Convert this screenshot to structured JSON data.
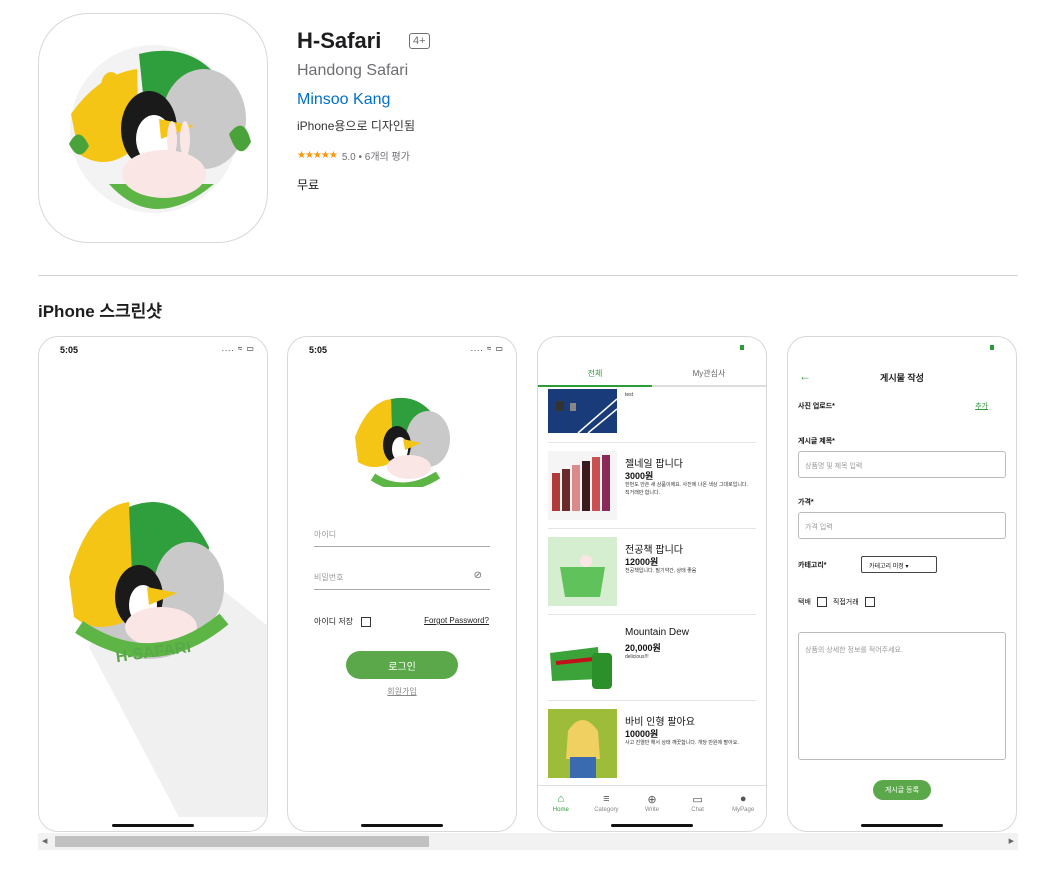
{
  "app": {
    "title": "H-Safari",
    "age_rating": "4+",
    "subtitle": "Handong Safari",
    "developer": "Minsoo Kang",
    "designed_for": "iPhone용으로 디자인됨",
    "stars": "★★★★★",
    "rating_text": "5.0 • 6개의 평가",
    "price": "무료",
    "accent_color": "#0070c9",
    "star_color": "#ff9500"
  },
  "screenshots_section": {
    "title": "iPhone 스크린샷"
  },
  "screen1": {
    "time": "5:05",
    "status_icons": ".... ≈ ▭",
    "logo_text": "H-SAFARI"
  },
  "screen2": {
    "time": "5:05",
    "status_icons": ".... ≈ ▭",
    "id_placeholder": "아이디",
    "password_placeholder": "비밀번호",
    "save_id_label": "아이디 저장",
    "forgot_password": "Forgot Password?",
    "login_button": "로그인",
    "signup_link": "회원가입"
  },
  "screen3": {
    "tabs": [
      "전체",
      "My관심사"
    ],
    "items": [
      {
        "title": "",
        "price": "",
        "desc": "test"
      },
      {
        "title": "젤네일 팝니다",
        "price": "3000원",
        "desc": "한번도 안쓴 새 상품이에요. 사진에 나온 색상 그대로입니다. 직거래만 합니다."
      },
      {
        "title": "전공책 팝니다",
        "price": "12000원",
        "desc": "전공책입니다. 필기약간, 상태 좋음"
      },
      {
        "title": "Mountain Dew",
        "price": "20,000원",
        "desc": "delicious!!!"
      },
      {
        "title": "바비 인형 팔아요",
        "price": "10000원",
        "desc": "사고 진열만 해서 상태 깨끗합니다. 개당 만원에 팔아요."
      }
    ],
    "nav": [
      {
        "icon": "home-icon",
        "label": "Home"
      },
      {
        "icon": "menu-icon",
        "label": "Category"
      },
      {
        "icon": "plus-circle-icon",
        "label": "Write"
      },
      {
        "icon": "chat-icon",
        "label": "Chat"
      },
      {
        "icon": "person-icon",
        "label": "MyPage"
      }
    ],
    "brand_color": "#2e9b3a"
  },
  "screen4": {
    "header": "게시물 작성",
    "photo_label": "사진 업로드*",
    "add_link": "추가",
    "title_label": "게시글 제목*",
    "title_placeholder": "상품명 및 제목 입력",
    "price_label": "가격*",
    "price_placeholder": "가격 입력",
    "category_label": "카테고리*",
    "category_select": "카테고리 미정 ▾",
    "delivery_label": "택배",
    "direct_label": "직접거래",
    "detail_placeholder": "상품의 상세한 정보를 적어주세요.",
    "submit_button": "게시글 등록"
  }
}
